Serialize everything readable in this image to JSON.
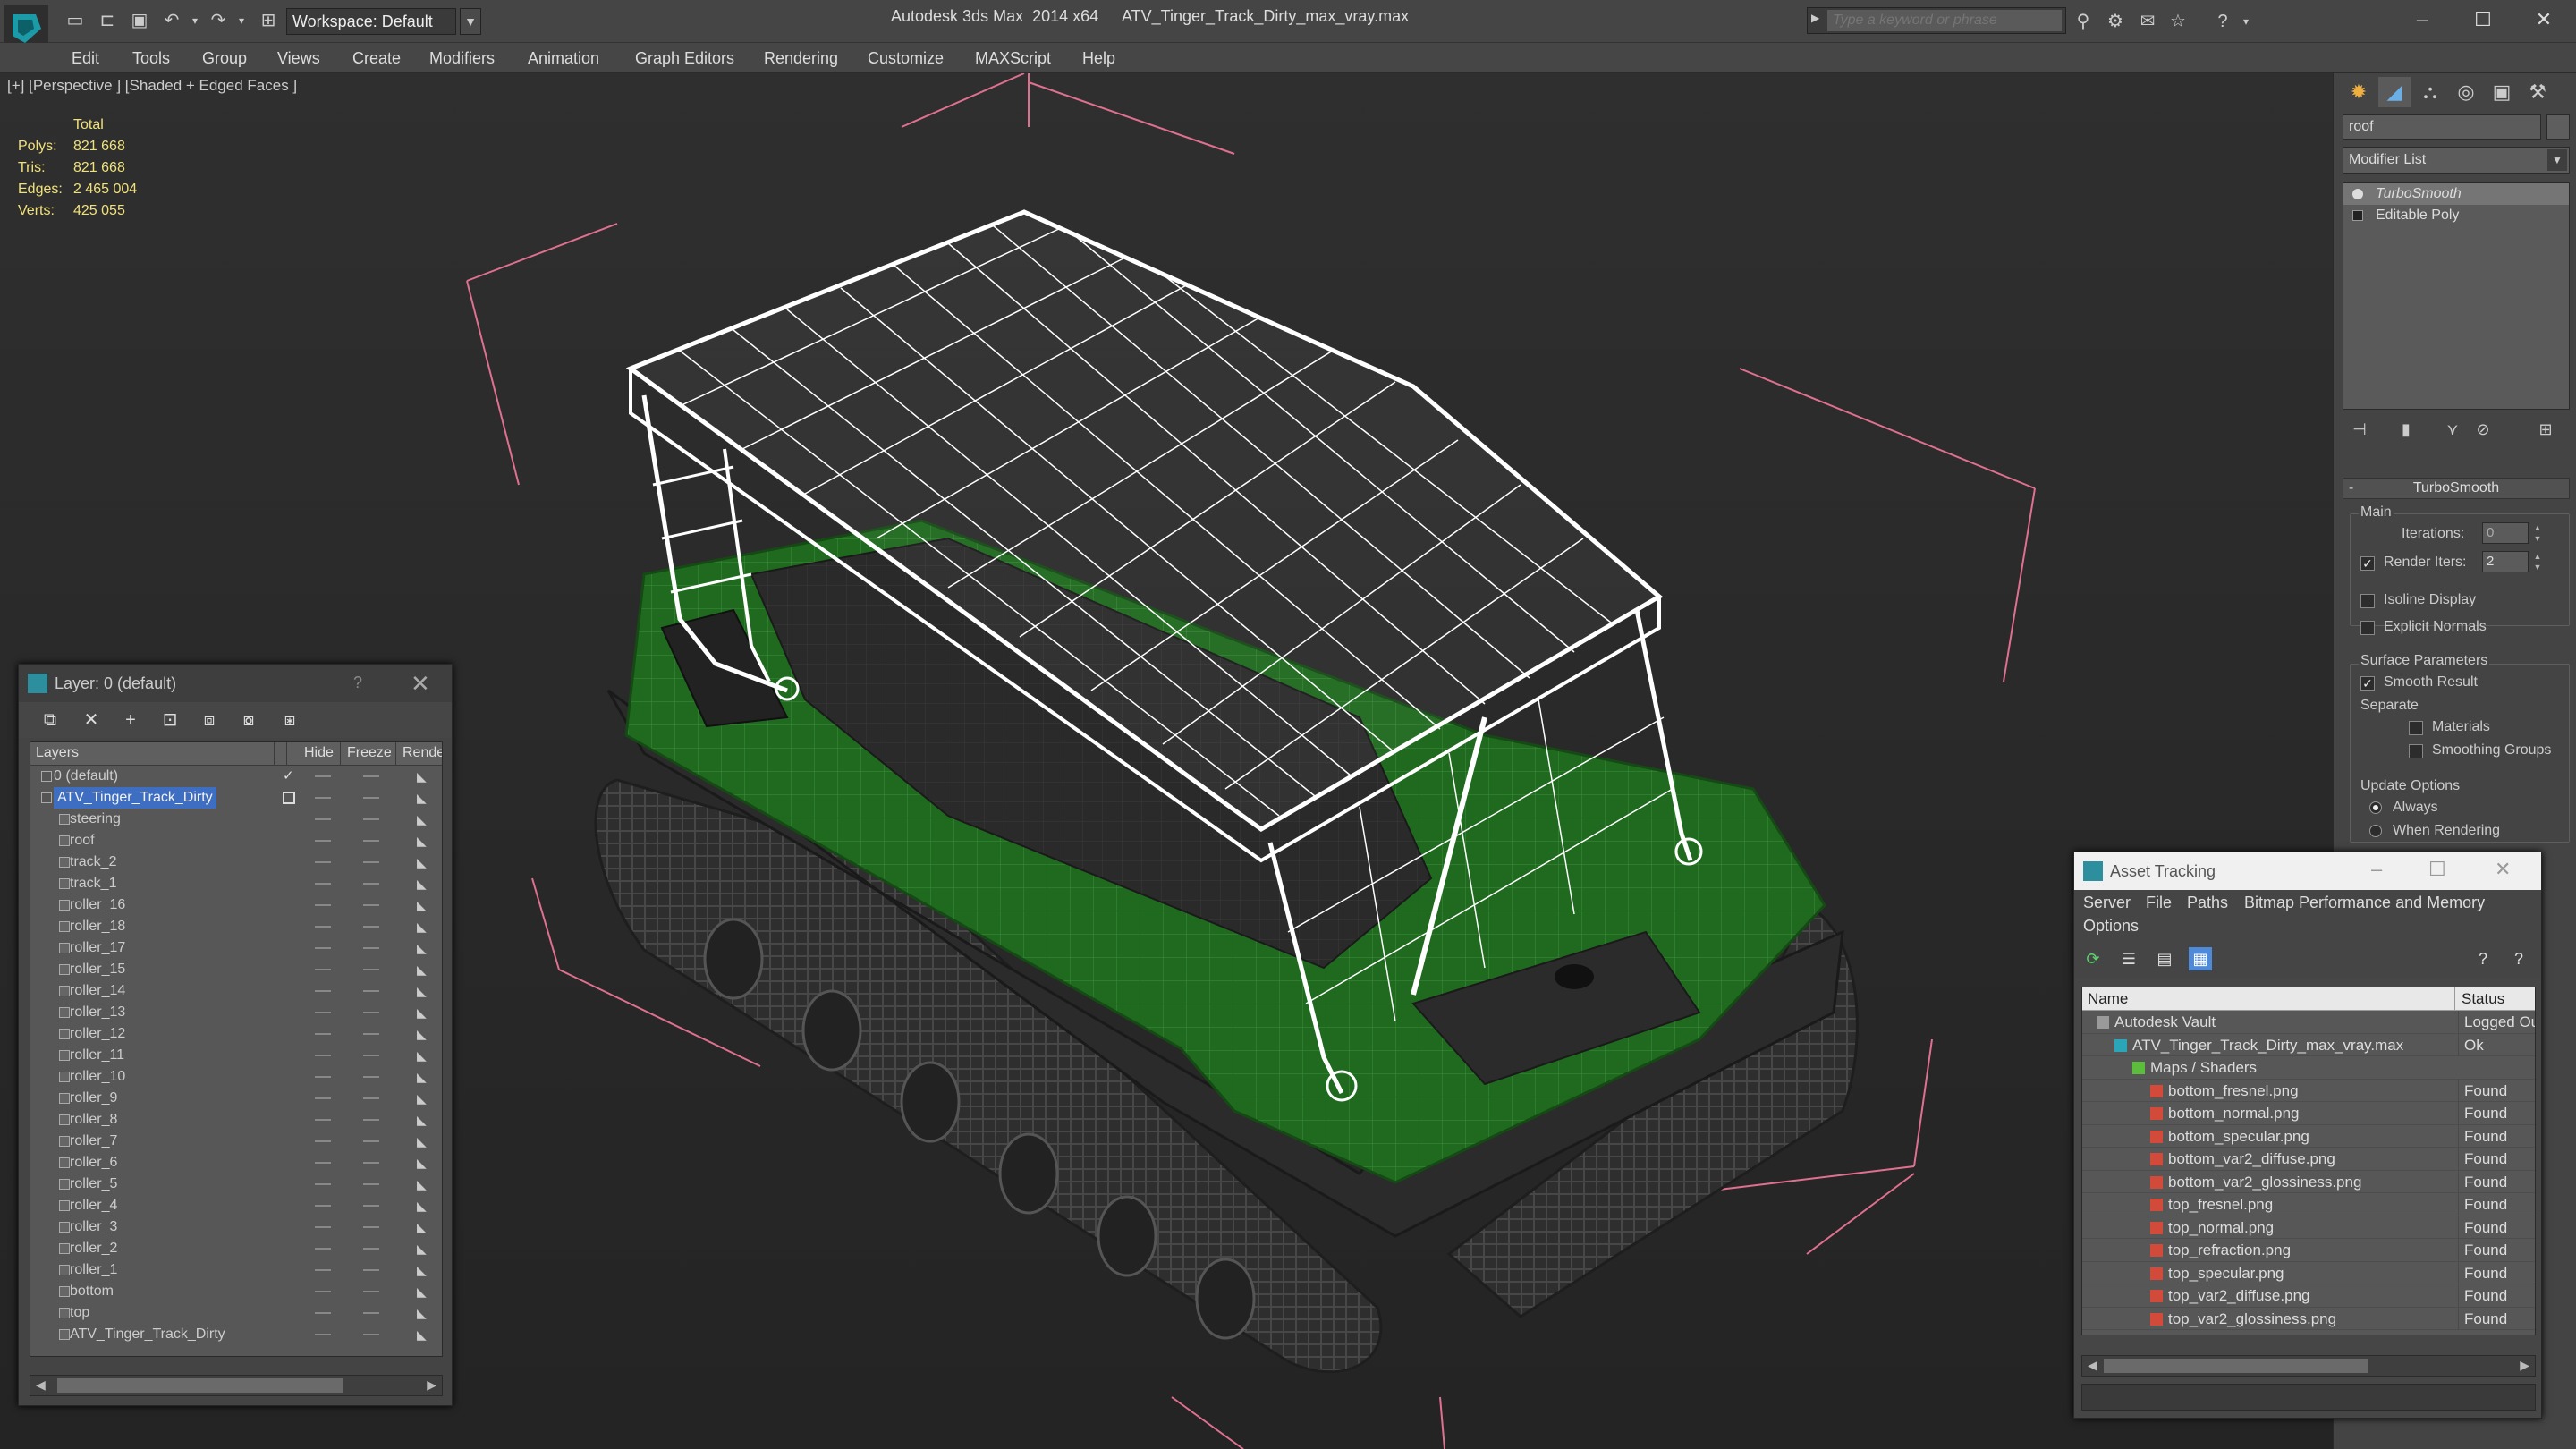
{
  "window": {
    "app_title": "Autodesk 3ds Max  2014 x64",
    "file_title": "ATV_Tinger_Track_Dirty_max_vray.max",
    "workspace": "Workspace: Default",
    "search_placeholder": "Type a keyword or phrase"
  },
  "menu": [
    "Edit",
    "Tools",
    "Group",
    "Views",
    "Create",
    "Modifiers",
    "Animation",
    "Graph Editors",
    "Rendering",
    "Customize",
    "MAXScript",
    "Help"
  ],
  "viewport": {
    "label": "[+] [Perspective ] [Shaded + Edged Faces ]",
    "stats": {
      "header": "Total",
      "rows": [
        {
          "label": "Polys:",
          "value": "821 668"
        },
        {
          "label": "Tris:",
          "value": "821 668"
        },
        {
          "label": "Edges:",
          "value": "2 465 004"
        },
        {
          "label": "Verts:",
          "value": "425 055"
        }
      ]
    },
    "colors": {
      "body": "#1f6a1f",
      "wire": "#ffffff",
      "track": "#3a3a3a",
      "helper": "#e07090"
    }
  },
  "command_panel": {
    "object_name": "roof",
    "modifier_list": "Modifier List",
    "stack": [
      {
        "label": "TurboSmooth",
        "selected": true
      },
      {
        "label": "Editable Poly",
        "selected": false
      }
    ],
    "rollout_title": "TurboSmooth",
    "main_group": "Main",
    "iterations_label": "Iterations:",
    "iterations_value": "0",
    "render_iters_label": "Render Iters:",
    "render_iters_value": "2",
    "isoline_display": "Isoline Display",
    "explicit_normals": "Explicit Normals",
    "surface_group": "Surface Parameters",
    "smooth_result": "Smooth Result",
    "separate_label": "Separate",
    "materials": "Materials",
    "smoothing_groups": "Smoothing Groups",
    "update_group": "Update Options",
    "always": "Always",
    "when_rendering": "When Rendering"
  },
  "layer_explorer": {
    "title": "Layer: 0 (default)",
    "help": "?",
    "columns": {
      "layers": "Layers",
      "hide": "Hide",
      "freeze": "Freeze",
      "render": "Rende"
    },
    "rows": [
      {
        "name": "0 (default)",
        "indent": 0,
        "kind": "layer",
        "selected": false,
        "current": true
      },
      {
        "name": "ATV_Tinger_Track_Dirty",
        "indent": 0,
        "kind": "layer",
        "selected": true,
        "current": false
      },
      {
        "name": "steering",
        "indent": 1,
        "kind": "object"
      },
      {
        "name": "roof",
        "indent": 1,
        "kind": "object"
      },
      {
        "name": "track_2",
        "indent": 1,
        "kind": "object"
      },
      {
        "name": "track_1",
        "indent": 1,
        "kind": "object"
      },
      {
        "name": "roller_16",
        "indent": 1,
        "kind": "object"
      },
      {
        "name": "roller_18",
        "indent": 1,
        "kind": "object"
      },
      {
        "name": "roller_17",
        "indent": 1,
        "kind": "object"
      },
      {
        "name": "roller_15",
        "indent": 1,
        "kind": "object"
      },
      {
        "name": "roller_14",
        "indent": 1,
        "kind": "object"
      },
      {
        "name": "roller_13",
        "indent": 1,
        "kind": "object"
      },
      {
        "name": "roller_12",
        "indent": 1,
        "kind": "object"
      },
      {
        "name": "roller_11",
        "indent": 1,
        "kind": "object"
      },
      {
        "name": "roller_10",
        "indent": 1,
        "kind": "object"
      },
      {
        "name": "roller_9",
        "indent": 1,
        "kind": "object"
      },
      {
        "name": "roller_8",
        "indent": 1,
        "kind": "object"
      },
      {
        "name": "roller_7",
        "indent": 1,
        "kind": "object"
      },
      {
        "name": "roller_6",
        "indent": 1,
        "kind": "object"
      },
      {
        "name": "roller_5",
        "indent": 1,
        "kind": "object"
      },
      {
        "name": "roller_4",
        "indent": 1,
        "kind": "object"
      },
      {
        "name": "roller_3",
        "indent": 1,
        "kind": "object"
      },
      {
        "name": "roller_2",
        "indent": 1,
        "kind": "object"
      },
      {
        "name": "roller_1",
        "indent": 1,
        "kind": "object"
      },
      {
        "name": "bottom",
        "indent": 1,
        "kind": "object"
      },
      {
        "name": "top",
        "indent": 1,
        "kind": "object"
      },
      {
        "name": "ATV_Tinger_Track_Dirty",
        "indent": 1,
        "kind": "object"
      }
    ]
  },
  "asset_tracking": {
    "title": "Asset Tracking",
    "menu": [
      "Server",
      "File",
      "Paths",
      "Bitmap Performance and Memory",
      "Options"
    ],
    "columns": {
      "name": "Name",
      "status": "Status"
    },
    "rows": [
      {
        "name": "Autodesk Vault",
        "status": "Logged Out",
        "indent": 0,
        "kind": "vault"
      },
      {
        "name": "ATV_Tinger_Track_Dirty_max_vray.max",
        "status": "Ok",
        "indent": 1,
        "kind": "max"
      },
      {
        "name": "Maps / Shaders",
        "status": "",
        "indent": 2,
        "kind": "maps"
      },
      {
        "name": "bottom_fresnel.png",
        "status": "Found",
        "indent": 3,
        "kind": "png"
      },
      {
        "name": "bottom_normal.png",
        "status": "Found",
        "indent": 3,
        "kind": "png"
      },
      {
        "name": "bottom_specular.png",
        "status": "Found",
        "indent": 3,
        "kind": "png"
      },
      {
        "name": "bottom_var2_diffuse.png",
        "status": "Found",
        "indent": 3,
        "kind": "png"
      },
      {
        "name": "bottom_var2_glossiness.png",
        "status": "Found",
        "indent": 3,
        "kind": "png"
      },
      {
        "name": "top_fresnel.png",
        "status": "Found",
        "indent": 3,
        "kind": "png"
      },
      {
        "name": "top_normal.png",
        "status": "Found",
        "indent": 3,
        "kind": "png"
      },
      {
        "name": "top_refraction.png",
        "status": "Found",
        "indent": 3,
        "kind": "png"
      },
      {
        "name": "top_specular.png",
        "status": "Found",
        "indent": 3,
        "kind": "png"
      },
      {
        "name": "top_var2_diffuse.png",
        "status": "Found",
        "indent": 3,
        "kind": "png"
      },
      {
        "name": "top_var2_glossiness.png",
        "status": "Found",
        "indent": 3,
        "kind": "png"
      }
    ]
  }
}
